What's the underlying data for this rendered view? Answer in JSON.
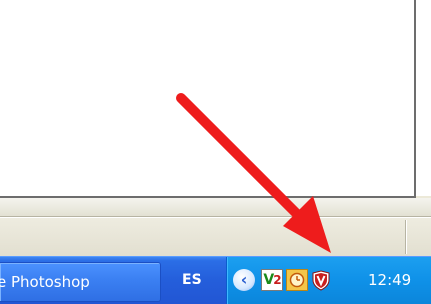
{
  "taskbar": {
    "task_button_label": "e Photoshop",
    "language_indicator": "ES",
    "tray": {
      "expand_glyph": "‹",
      "icons": [
        "v2-icon",
        "clock-icon",
        "shield-icon"
      ],
      "v2_text_v": "V",
      "v2_text_2": "2"
    },
    "clock": "12:49"
  },
  "colors": {
    "taskbar_blue": "#245edb",
    "tray_blue": "#0f91e8",
    "arrow_red": "#ee1c1c"
  }
}
